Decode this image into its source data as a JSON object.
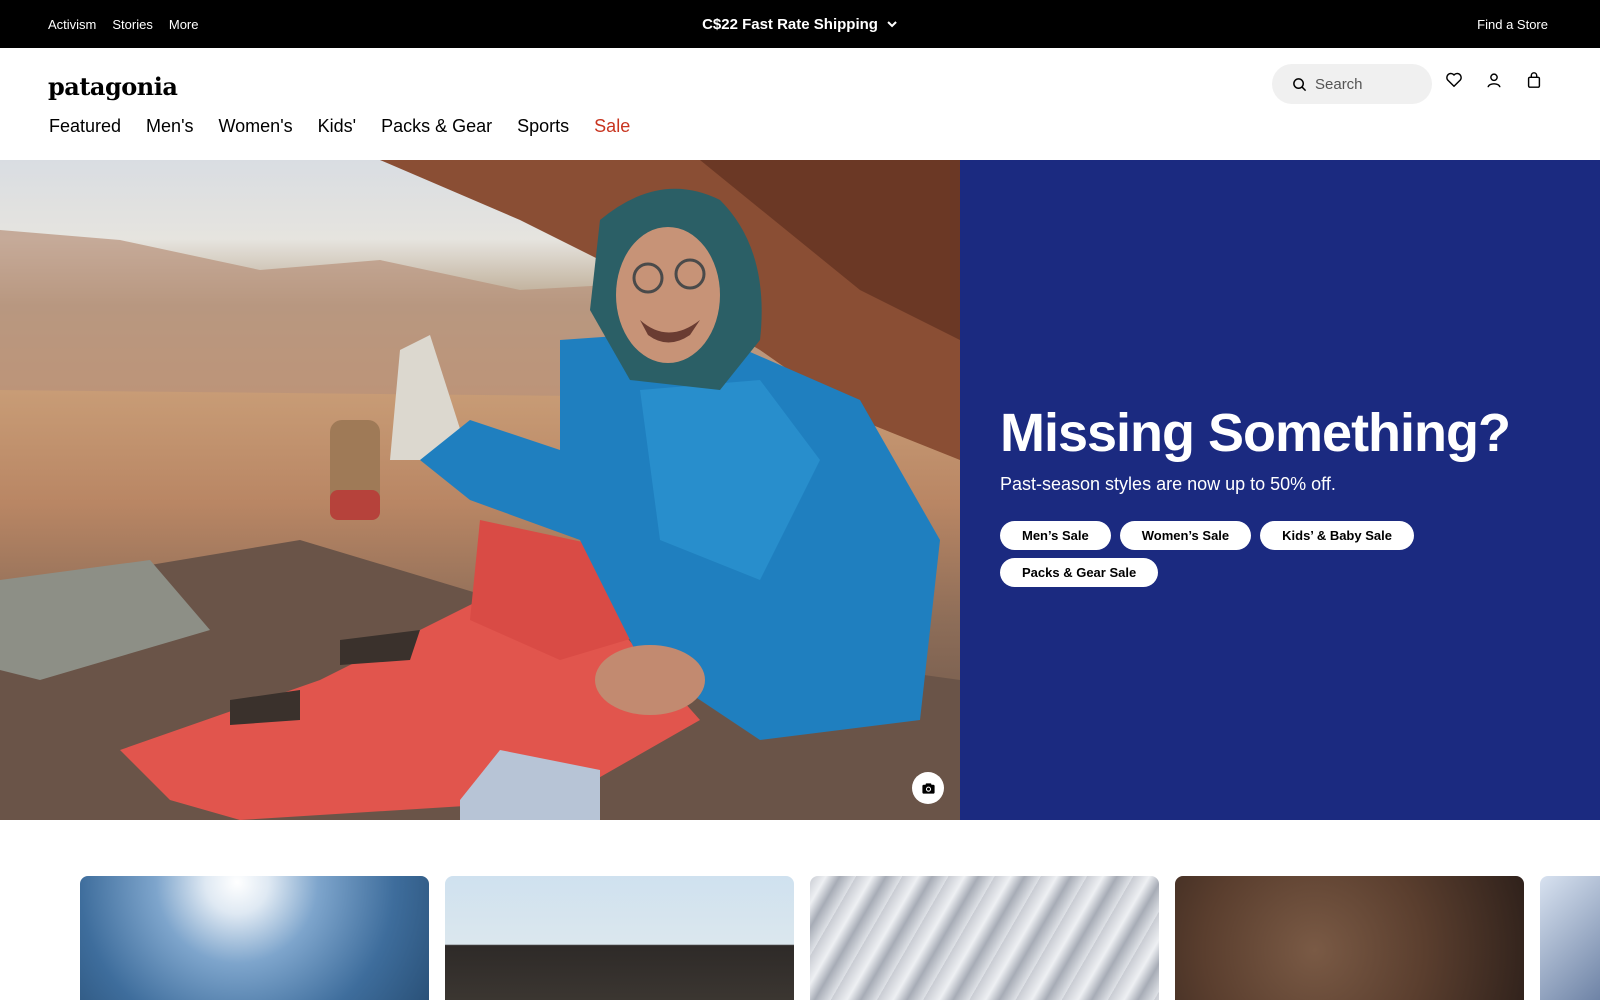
{
  "topbar": {
    "links": [
      "Activism",
      "Stories",
      "More"
    ],
    "promo": "C$22 Fast Rate Shipping",
    "find_store": "Find a Store"
  },
  "header": {
    "logo": "patagonia",
    "search_placeholder": "Search",
    "icons": [
      "heart-icon",
      "account-icon",
      "bag-icon"
    ]
  },
  "nav": {
    "items": [
      "Featured",
      "Men's",
      "Women's",
      "Kids'",
      "Packs & Gear",
      "Sports",
      "Sale"
    ]
  },
  "hero": {
    "title": "Missing Something?",
    "subtitle": "Past-season styles are now up to 50% off.",
    "buttons": [
      "Men’s Sale",
      "Women’s Sale",
      "Kids’ & Baby Sale",
      "Packs & Gear Sale"
    ],
    "panel_color": "#1b2a80"
  },
  "colors": {
    "sale": "#c8341f",
    "topbar": "#000000"
  }
}
